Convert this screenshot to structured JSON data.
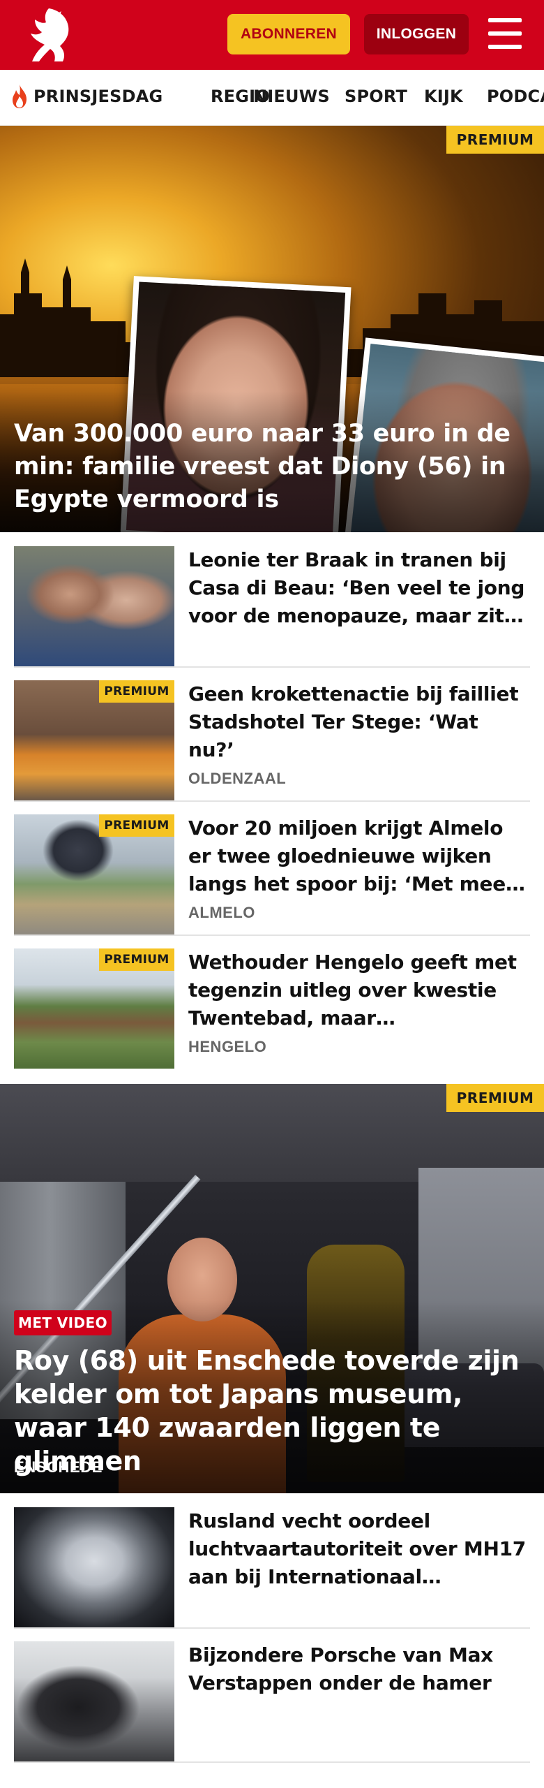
{
  "header": {
    "logo_name": "tubantia-logo",
    "subscribe_label": "ABONNEREN",
    "login_label": "INLOGGEN",
    "brand_color": "#d0021b",
    "accent_color": "#f5c322"
  },
  "nav": {
    "items": [
      "PRINSJESDAG",
      "REGIO",
      "NIEUWS",
      "SPORT",
      "KIJK",
      "PODCA"
    ]
  },
  "hero_top": {
    "badge": "PREMIUM",
    "title": "Van 300.000 euro naar 33 euro in de min: familie vreest dat Diony (56) in Egypte vermoord is"
  },
  "articles": [
    {
      "title": "Leonie ter Braak in tranen bij Casa di Beau: ‘Ben veel te jong voor de menopauze, maar zit er…",
      "badge": "",
      "location": ""
    },
    {
      "title": "Geen krokettenactie bij failliet Stadshotel Ter Stege: ‘Wat nu?’",
      "badge": "PREMIUM",
      "location": "OLDENZAAL"
    },
    {
      "title": "Voor 20 miljoen krijgt Almelo er twee gloednieuwe wijken langs het spoor bij: ‘Met meer dan…",
      "badge": "PREMIUM",
      "location": "ALMELO"
    },
    {
      "title": "Wethouder Hengelo geeft met tegenzin uitleg over kwestie Twentebad, maar onduidelijkhe…",
      "badge": "PREMIUM",
      "location": "HENGELO"
    }
  ],
  "hero_mid": {
    "badge": "PREMIUM",
    "video_badge": "MET VIDEO",
    "title": "Roy (68) uit Enschede toverde zijn kelder om tot Japans museum, waar 140 zwaarden liggen te glimmen",
    "location": "ENSCHEDE"
  },
  "articles_bottom": [
    {
      "title": "Rusland vecht oordeel luchtvaartautoriteit over MH17 aan bij Internationaal Gerechts-…"
    },
    {
      "title": "Bijzondere Porsche van Max Verstappen onder de hamer"
    }
  ]
}
